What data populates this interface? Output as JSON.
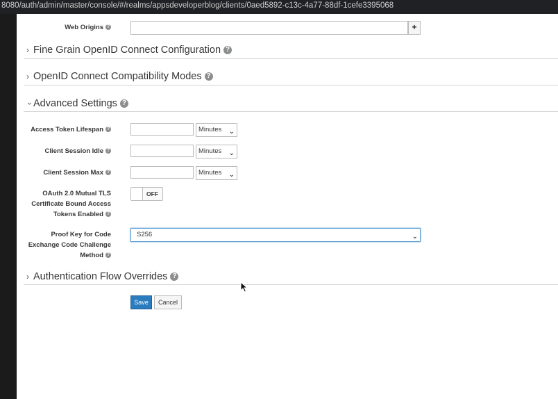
{
  "browser": {
    "url": "8080/auth/admin/master/console/#/realms/appsdeveloperblog/clients/0aed5892-c13c-4a77-88df-1cefe3395068"
  },
  "web_origins": {
    "label": "Web Origins",
    "value": "",
    "add_label": "+"
  },
  "sections": {
    "fine_grain": "Fine Grain OpenID Connect Configuration",
    "compat": "OpenID Connect Compatibility Modes",
    "advanced": "Advanced Settings",
    "auth_flow": "Authentication Flow Overrides"
  },
  "advanced": {
    "access_token_lifespan": {
      "label": "Access Token Lifespan",
      "value": "",
      "unit": "Minutes"
    },
    "client_session_idle": {
      "label": "Client Session Idle",
      "value": "",
      "unit": "Minutes"
    },
    "client_session_max": {
      "label": "Client Session Max",
      "value": "",
      "unit": "Minutes"
    },
    "oauth_mtls": {
      "label_line1": "OAuth 2.0 Mutual TLS",
      "label_line2": "Certificate Bound Access",
      "label_line3": "Tokens Enabled",
      "state": "OFF"
    },
    "pkce": {
      "label_line1": "Proof Key for Code",
      "label_line2": "Exchange Code Challenge",
      "label_line3": "Method",
      "value": "S256"
    }
  },
  "buttons": {
    "save": "Save",
    "cancel": "Cancel"
  },
  "colors": {
    "primary": "#2b7bbf",
    "focus": "#5e9ed6"
  }
}
